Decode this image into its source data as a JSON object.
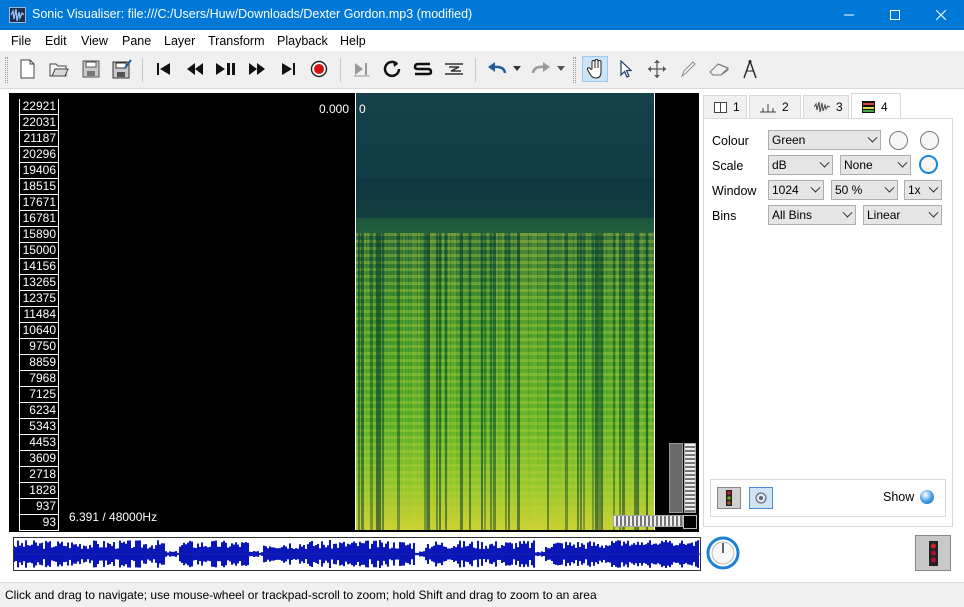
{
  "window": {
    "title": "Sonic Visualiser: file:///C:/Users/Huw/Downloads/Dexter Gordon.mp3 (modified)"
  },
  "menu": [
    "File",
    "Edit",
    "View",
    "Pane",
    "Layer",
    "Transform",
    "Playback",
    "Help"
  ],
  "toolbar": {
    "file_buttons": [
      "new-session-icon",
      "open-icon",
      "save-icon",
      "save-as-icon"
    ],
    "transport_buttons": [
      "rewind-start-icon",
      "rewind-icon",
      "play-pause-icon",
      "fast-forward-icon",
      "fast-forward-end-icon",
      "record-icon"
    ],
    "play_mode_buttons": [
      "play-selection-icon",
      "loop-icon",
      "solo-icon",
      "align-icon"
    ],
    "history_buttons": [
      "undo-icon",
      "redo-icon"
    ],
    "tool_buttons": [
      "navigate-icon",
      "select-icon",
      "move-icon",
      "draw-icon",
      "erase-icon",
      "measure-icon"
    ],
    "active_tool": "navigate-icon",
    "accent": "#cce4f7"
  },
  "pane": {
    "scale_ticks": [
      "22921",
      "22031",
      "21187",
      "20296",
      "19406",
      "18515",
      "17671",
      "16781",
      "15890",
      "15000",
      "14156",
      "13265",
      "12375",
      "11484",
      "10640",
      "9750",
      "8859",
      "7968",
      "7125",
      "6234",
      "5343",
      "4453",
      "3609",
      "2718",
      "1828",
      "937",
      "93"
    ],
    "time_readout": "0.000",
    "frame_readout": "0",
    "rate_readout": "6.391 / 48000Hz"
  },
  "panel": {
    "tabs": [
      {
        "num": "1",
        "icon": "pane-layout-icon"
      },
      {
        "num": "2",
        "icon": "time-ruler-icon"
      },
      {
        "num": "3",
        "icon": "waveform-icon"
      },
      {
        "num": "4",
        "icon": "spectrogram-icon"
      }
    ],
    "active_tab": 3,
    "rows": {
      "colour_label": "Colour",
      "colour_value": "Green",
      "scale_label": "Scale",
      "scale_value": "dB",
      "scale_norm": "None",
      "window_label": "Window",
      "window_value": "1024",
      "window_overlap": "50 %",
      "window_oversample": "1x",
      "bins_label": "Bins",
      "bins_value": "All Bins",
      "bins_scale": "Linear"
    },
    "show_label": "Show",
    "show_color": "#4a9fe8"
  },
  "status": {
    "text": "Click and drag to navigate; use mouse-wheel or trackpad-scroll to zoom; hold Shift and drag to zoom to an area"
  },
  "colors": {
    "titlebar": "#0078d7",
    "waveform": "#0a16b8",
    "spectrogram_low": "#0e3b3a",
    "spectrogram_high": "#c8d832"
  }
}
